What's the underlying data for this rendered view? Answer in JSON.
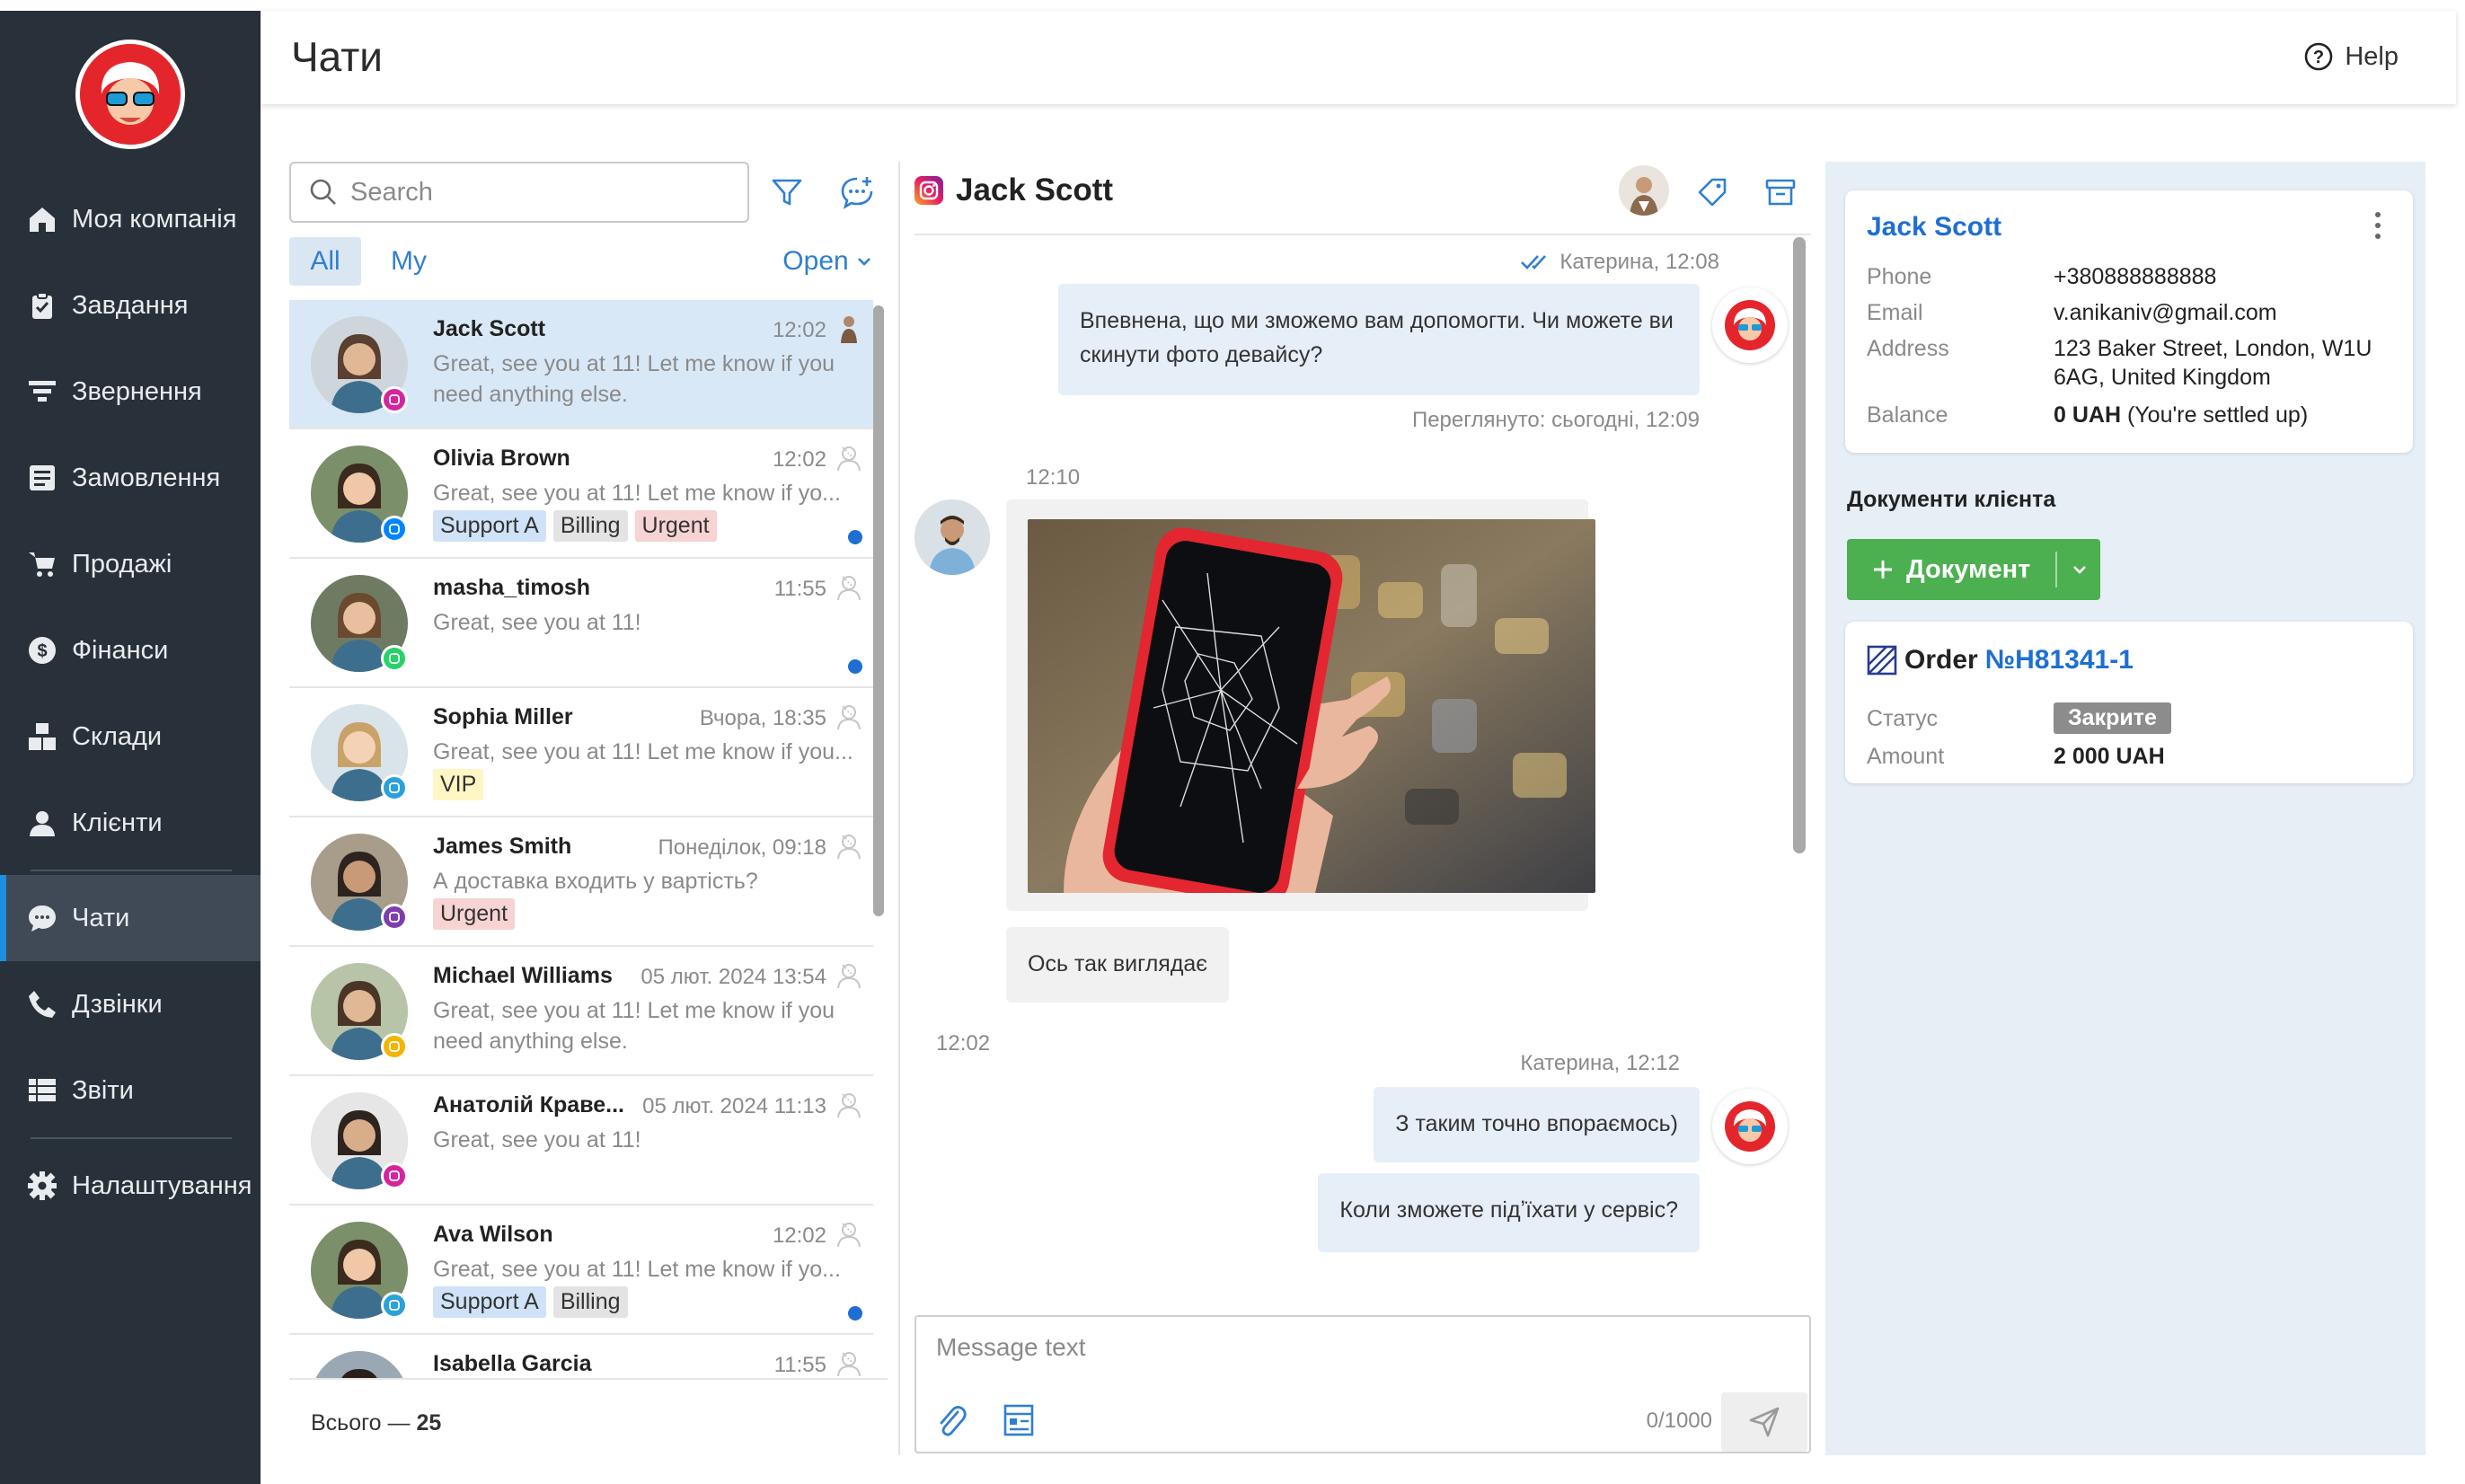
{
  "sidebar": {
    "items": [
      {
        "label": "Моя компанія",
        "icon": "home-icon"
      },
      {
        "label": "Завдання",
        "icon": "clipboard-check-icon"
      },
      {
        "label": "Звернення",
        "icon": "funnel-icon"
      },
      {
        "label": "Замовлення",
        "icon": "order-list-icon"
      },
      {
        "label": "Продажі",
        "icon": "cart-icon"
      },
      {
        "label": "Фінанси",
        "icon": "dollar-icon"
      },
      {
        "label": "Склади",
        "icon": "warehouse-boxes-icon"
      },
      {
        "label": "Клієнти",
        "icon": "user-icon"
      },
      {
        "label": "Чати",
        "icon": "chat-icon"
      },
      {
        "label": "Дзвінки",
        "icon": "phone-icon"
      },
      {
        "label": "Звіти",
        "icon": "table-icon"
      },
      {
        "label": "Налаштування",
        "icon": "gear-icon"
      }
    ],
    "active": "Чати"
  },
  "header": {
    "title": "Чати",
    "help_label": "Help"
  },
  "chat_list": {
    "search_placeholder": "Search",
    "tabs": [
      "All",
      "My"
    ],
    "filter_label": "Open",
    "chats": [
      {
        "name": "Jack Scott",
        "time": "12:02",
        "message": "Great, see you at 11! Let me know if you need anything else.",
        "channel": "instagram",
        "tags": [],
        "unread": false,
        "selected": true
      },
      {
        "name": "Olivia Brown",
        "time": "12:02",
        "message": "Great, see you at 11! Let me know if yo...",
        "channel": "messenger",
        "tags": [
          "Support A",
          "Billing",
          "Urgent"
        ],
        "unread": true
      },
      {
        "name": "masha_timosh",
        "time": "11:55",
        "message": "Great, see you at 11!",
        "channel": "whatsapp",
        "tags": [],
        "unread": true
      },
      {
        "name": "Sophia Miller",
        "time": "Вчора, 18:35",
        "message": "Great, see you at 11! Let me know if you...",
        "channel": "telegram",
        "tags": [
          "VIP"
        ],
        "unread": false
      },
      {
        "name": "James Smith",
        "time": "Понеділок, 09:18",
        "message": "А доставка входить у вартість?",
        "channel": "viber",
        "tags": [
          "Urgent"
        ],
        "unread": false
      },
      {
        "name": "Michael Williams",
        "time": "05 лют. 2024 13:54",
        "message": "Great, see you at 11! Let me know if you need anything else.",
        "channel": "other",
        "tags": [],
        "unread": false
      },
      {
        "name": "Анатолій Краве...",
        "time": "05 лют. 2024 11:13",
        "message": "Great, see you at 11!",
        "channel": "instagram",
        "tags": [],
        "unread": false
      },
      {
        "name": "Ava Wilson",
        "time": "12:02",
        "message": "Great, see you at 11! Let me know if yo...",
        "channel": "telegram",
        "tags": [
          "Support A",
          "Billing"
        ],
        "unread": true
      },
      {
        "name": "Isabella Garcia",
        "time": "11:55",
        "message": "",
        "channel": "",
        "tags": [],
        "unread": false
      }
    ],
    "total_label": "Всього —",
    "total_value": "25"
  },
  "conversation": {
    "contact_name": "Jack Scott",
    "messages": [
      {
        "meta": "Катерина, 12:08",
        "text": "Впевнена, що ми зможемо вам допомогти. Чи можете ви скинути фото девайсу?",
        "seen": "Переглянуто: сьогодні, 12:09"
      },
      {
        "time": "12:10",
        "image_alt": "Phone with cracked screen",
        "caption": "Ось так виглядає"
      },
      {
        "time": "12:02"
      },
      {
        "meta": "Катерина, 12:12",
        "text": "З таким точно впораємось)"
      },
      {
        "text": "Коли зможете підʼїхати у сервіс?"
      }
    ],
    "input_placeholder": "Message text",
    "char_count": "0/1000"
  },
  "client": {
    "name": "Jack Scott",
    "phone_label": "Phone",
    "phone": "+380888888888",
    "email_label": "Email",
    "email": "v.anikaniv@gmail.com",
    "address_label": "Address",
    "address_line1": "123 Baker Street, London, W1U",
    "address_line2": "6AG, United Kingdom",
    "balance_label": "Balance",
    "balance_value": "0 UAH",
    "balance_note": "(You're settled up)",
    "docs_title": "Документи клієнта",
    "doc_button": "Документ",
    "order_prefix": "Order",
    "order_number": "№H81341-1",
    "status_label": "Статус",
    "status_value": "Закрите",
    "amount_label": "Amount",
    "amount_value": "2 000 UAH"
  },
  "colors": {
    "sidebar": "#283039",
    "accent": "#1e8fe0",
    "green": "#4caf50",
    "panel": "#e6eef6"
  }
}
